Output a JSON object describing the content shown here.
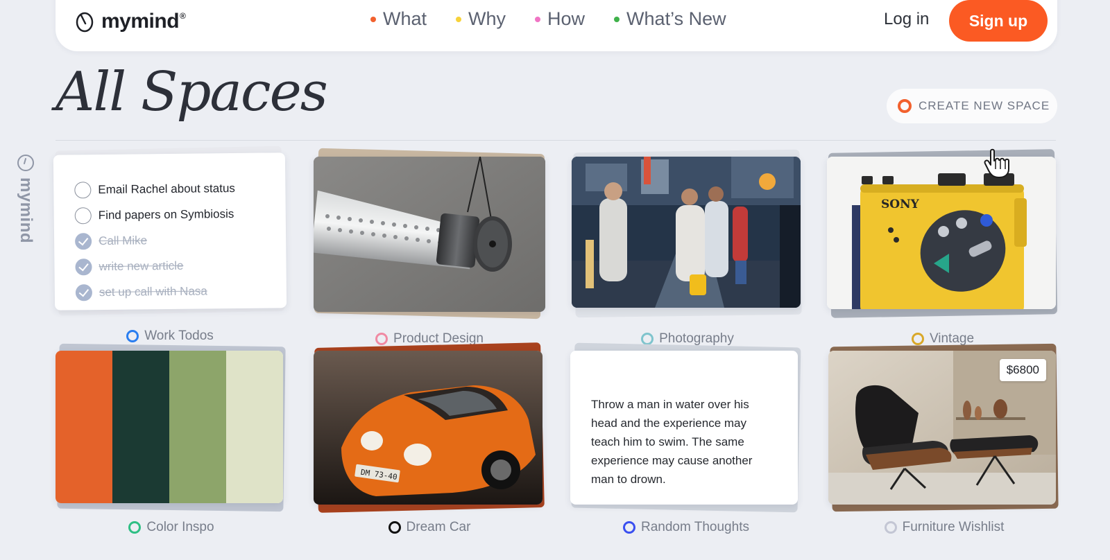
{
  "header": {
    "logo_text": "mymind",
    "logo_mark": "®",
    "nav": [
      {
        "label": "What",
        "dot_color": "#f2612e"
      },
      {
        "label": "Why",
        "dot_color": "#f7d23a"
      },
      {
        "label": "How",
        "dot_color": "#f074c4"
      },
      {
        "label": "What’s New",
        "dot_color": "#3fb14a"
      }
    ],
    "login_label": "Log in",
    "signup_label": "Sign up",
    "accent_color": "#fb5a23"
  },
  "page": {
    "title": "All Spaces",
    "create_label": "CREATE NEW SPACE",
    "side_label": "mymind"
  },
  "spaces": [
    {
      "label": "Work Todos",
      "ring_color": "#2a7ef0",
      "todos": [
        {
          "text": "Email Rachel about status",
          "done": false
        },
        {
          "text": "Find papers on Symbiosis",
          "done": false
        },
        {
          "text": "Call Mike",
          "done": true
        },
        {
          "text": "write new article",
          "done": true
        },
        {
          "text": "set up call with Nasa",
          "done": true
        }
      ]
    },
    {
      "label": "Product Design",
      "ring_color": "#f08aa3"
    },
    {
      "label": "Photography",
      "ring_color": "#7fc4cd"
    },
    {
      "label": "Vintage",
      "ring_color": "#d9a829",
      "brand_text": "SONY"
    },
    {
      "label": "Color Inspo",
      "ring_color": "#2fbf84",
      "swatches": [
        "#e4622a",
        "#1b3a33",
        "#8da56a",
        "#dfe3c8"
      ]
    },
    {
      "label": "Dream Car",
      "ring_color": "#111111",
      "plate_text": "DM 73-40"
    },
    {
      "label": "Random Thoughts",
      "ring_color": "#3a4ff0",
      "quote": "Throw a man in water over his head and the experience may teach him to swim. The same experience may cause another man to drown."
    },
    {
      "label": "Furniture Wishlist",
      "ring_color": "#c3c6d4",
      "price": "$6800"
    }
  ]
}
